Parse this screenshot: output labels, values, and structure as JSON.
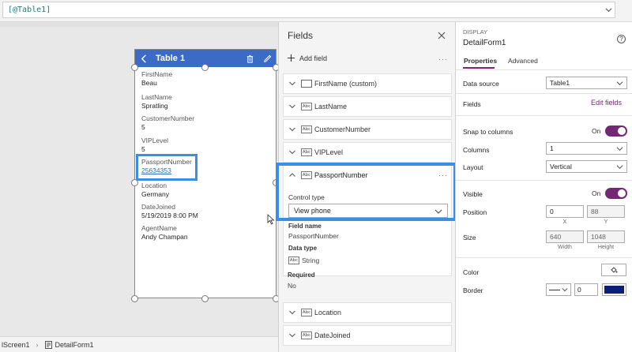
{
  "formula": {
    "text": "[@Table1]"
  },
  "form": {
    "title": "Table 1",
    "cards": [
      {
        "label": "FirstName",
        "value": "Beau"
      },
      {
        "label": "LastName",
        "value": "Spratling"
      },
      {
        "label": "CustomerNumber",
        "value": "5"
      },
      {
        "label": "VIPLevel",
        "value": "5"
      },
      {
        "label": "PassportNumber",
        "value": "25634353"
      },
      {
        "label": "Location",
        "value": "Germany"
      },
      {
        "label": "DateJoined",
        "value": "5/19/2019 8:00 PM"
      },
      {
        "label": "AgentName",
        "value": "Andy Champan"
      }
    ]
  },
  "breadcrumb": {
    "screen": "lScreen1",
    "form": "DetailForm1"
  },
  "fields_panel": {
    "title": "Fields",
    "add_field": "Add field",
    "more": "···",
    "fields": [
      {
        "name": "FirstName (custom)",
        "type_icon": "card-icon"
      },
      {
        "name": "LastName",
        "type_icon": "Abc"
      },
      {
        "name": "CustomerNumber",
        "type_icon": "Abc"
      },
      {
        "name": "VIPLevel",
        "type_icon": "Abc"
      }
    ],
    "expanded": {
      "name": "PassportNumber",
      "type_icon": "Abc",
      "control_type_label": "Control type",
      "control_type_value": "View phone",
      "field_name_label": "Field name",
      "field_name_value": "PassportNumber",
      "data_type_label": "Data type",
      "data_type_icon": "Abc",
      "data_type_value": "String",
      "required_label": "Required",
      "required_value": "No"
    },
    "fields_after": [
      {
        "name": "Location",
        "type_icon": "Abc"
      },
      {
        "name": "DateJoined",
        "type_icon": "Abc"
      }
    ]
  },
  "properties": {
    "kicker": "DISPLAY",
    "name": "DetailForm1",
    "help": "?",
    "tabs": [
      "Properties",
      "Advanced"
    ],
    "data_source_label": "Data source",
    "data_source_value": "Table1",
    "fields_label": "Fields",
    "edit_fields": "Edit fields",
    "snap_label": "Snap to columns",
    "snap_state": "On",
    "columns_label": "Columns",
    "columns_value": "1",
    "layout_label": "Layout",
    "layout_value": "Vertical",
    "visible_label": "Visible",
    "visible_state": "On",
    "position_label": "Position",
    "x_value": "0",
    "y_value": "88",
    "x_caption": "X",
    "y_caption": "Y",
    "size_label": "Size",
    "width_value": "640",
    "height_value": "1048",
    "width_caption": "Width",
    "height_caption": "Height",
    "color_label": "Color",
    "border_label": "Border",
    "border_width": "0",
    "border_color": "#0b1f78",
    "accent": "#742774",
    "header_color": "#3b6bc5",
    "highlight_color": "#3a8ee6"
  }
}
